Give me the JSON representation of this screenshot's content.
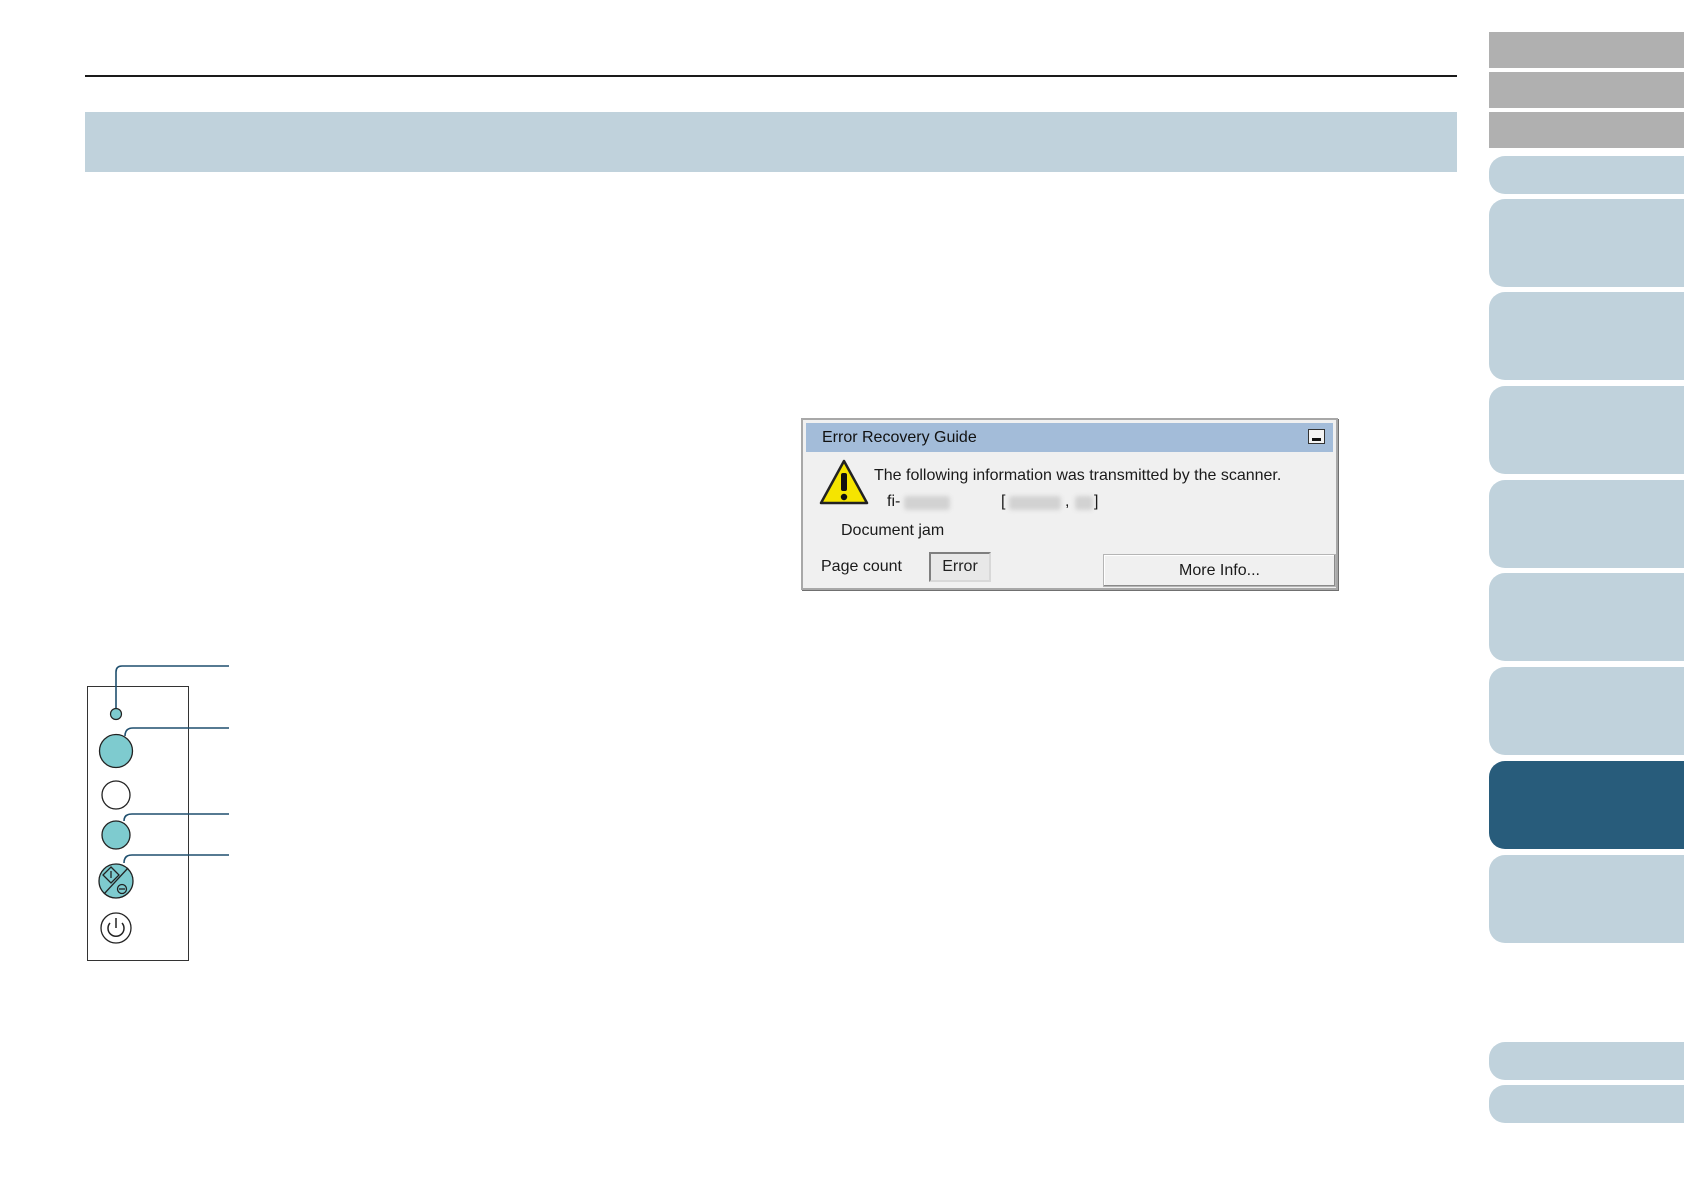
{
  "dialog": {
    "title": "Error Recovery Guide",
    "message": "The following information was transmitted by the scanner.",
    "model_prefix": "fi-",
    "bracket_open": "[",
    "bracket_sep": ",",
    "bracket_close": "]",
    "error_text": "Document jam",
    "page_count_label": "Page count",
    "error_field_value": "Error",
    "more_info_label": "More Info..."
  },
  "colors": {
    "heading_band": "#c0d2dc",
    "nav_tab": "#c0d2dc",
    "nav_tab_active": "#285c7b",
    "nav_tab_gray": "#b0b0b0",
    "dialog_title_bar": "#a3bcd9",
    "panel_button_teal": "#7ecbcf"
  },
  "operator_panel": {
    "items": [
      {
        "name": "indicator-led",
        "color": "teal"
      },
      {
        "name": "button-1",
        "color": "teal"
      },
      {
        "name": "button-2",
        "color": "white"
      },
      {
        "name": "button-3",
        "color": "teal"
      },
      {
        "name": "scan-stop-button",
        "icon": "scan-stop-icon",
        "color": "teal"
      },
      {
        "name": "power-button",
        "icon": "power-icon",
        "color": "white"
      }
    ]
  }
}
